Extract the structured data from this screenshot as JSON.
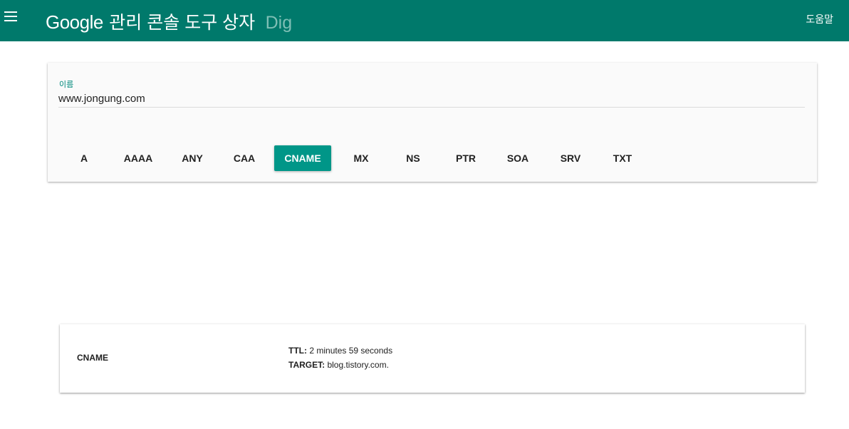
{
  "header": {
    "brand_google": "Google",
    "brand_title": "관리 콘솔 도구 상자",
    "brand_tool": "Dig",
    "help_label": "도움말",
    "menu_icon": "hamburger-menu-icon",
    "background_color": "#00796b"
  },
  "query": {
    "name_label": "이름",
    "name_value": "www.jongung.com",
    "accent_color": "#009688",
    "record_types": [
      {
        "label": "A",
        "selected": false
      },
      {
        "label": "AAAA",
        "selected": false
      },
      {
        "label": "ANY",
        "selected": false
      },
      {
        "label": "CAA",
        "selected": false
      },
      {
        "label": "CNAME",
        "selected": true
      },
      {
        "label": "MX",
        "selected": false
      },
      {
        "label": "NS",
        "selected": false
      },
      {
        "label": "PTR",
        "selected": false
      },
      {
        "label": "SOA",
        "selected": false
      },
      {
        "label": "SRV",
        "selected": false
      },
      {
        "label": "TXT",
        "selected": false
      }
    ]
  },
  "result": {
    "record_type": "CNAME",
    "ttl_label": "TTL:",
    "ttl_value": "2 minutes 59 seconds",
    "target_label": "TARGET:",
    "target_value": "blog.tistory.com."
  }
}
